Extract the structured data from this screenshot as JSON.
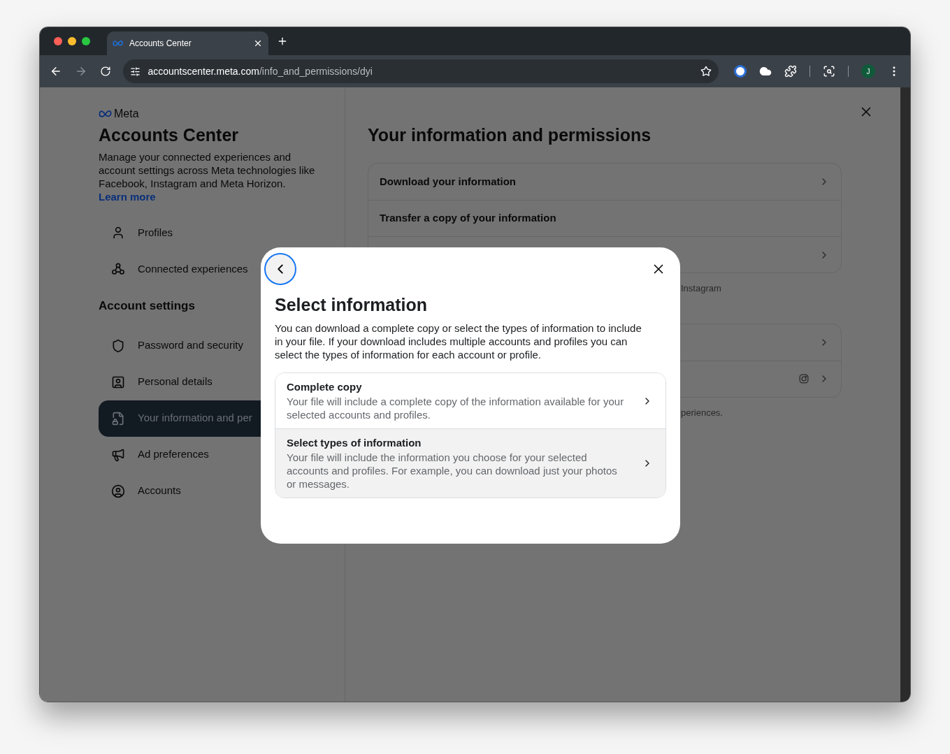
{
  "browser": {
    "tab": {
      "title": "Accounts Center",
      "selected": true
    },
    "address": {
      "host": "accountscenter.meta.com",
      "path": "/info_and_permissions/dyi"
    },
    "profile_initial": "J"
  },
  "sidebar": {
    "brand": "Meta",
    "title": "Accounts Center",
    "description": "Manage your connected experiences and account settings across Meta technologies like Facebook, Instagram and Meta Horizon.",
    "link": "Learn more",
    "items": [
      {
        "label": "Profiles",
        "selected": false
      },
      {
        "label": "Connected experiences",
        "selected": false
      }
    ],
    "section_title": "Account settings",
    "settings_items": [
      {
        "label": "Password and security",
        "selected": false
      },
      {
        "label": "Personal details",
        "selected": false
      },
      {
        "label": "Your information and per",
        "selected": true
      },
      {
        "label": "Ad preferences",
        "selected": false
      },
      {
        "label": "Accounts",
        "selected": false
      }
    ]
  },
  "main": {
    "title": "Your information and permissions",
    "cards": [
      {
        "rows": [
          {
            "label": "Download your information",
            "chevron": true,
            "app_icon": false
          },
          {
            "label": "Transfer a copy of your information",
            "chevron": false,
            "app_icon": false
          },
          {
            "chevron": true,
            "app_icon": false
          }
        ],
        "caption": "Instagram"
      },
      {
        "rows": [
          {
            "chevron": true,
            "app_icon": false
          },
          {
            "chevron": true,
            "app_icon": true
          }
        ],
        "caption": "periences."
      }
    ]
  },
  "dialog": {
    "back_button": {
      "focused": true
    },
    "title": "Select information",
    "description": "You can download a complete copy or select the types of information to include in your file. If your download includes multiple accounts and profiles you can select the types of information for each account or profile.",
    "options": [
      {
        "title": "Complete copy",
        "description": "Your file will include a complete copy of the information available for your selected accounts and profiles.",
        "highlighted": false
      },
      {
        "title": "Select types of information",
        "description": "Your file will include the information you choose for your selected accounts and profiles. For example, you can download just your photos or messages.",
        "highlighted": true
      }
    ]
  }
}
